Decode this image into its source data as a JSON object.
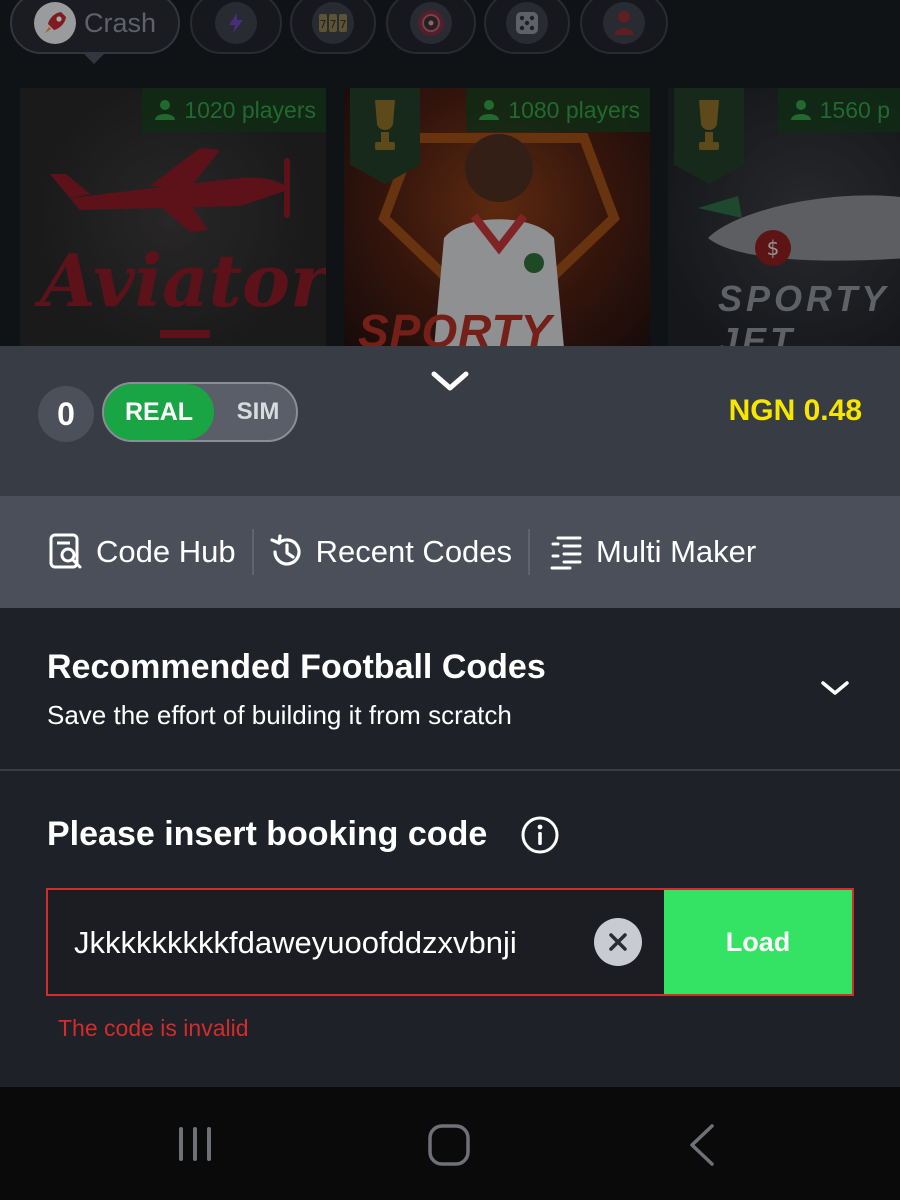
{
  "categories": {
    "active_label": "Crash",
    "icons": [
      "rocket-icon",
      "lightning-icon",
      "slots-icon",
      "roulette-icon",
      "dice-icon",
      "live-dealer-icon"
    ]
  },
  "games": [
    {
      "name": "Aviator",
      "players": "1020 players"
    },
    {
      "name": "SPORTY HERO",
      "players": "1080 players"
    },
    {
      "name": "SPORTY JET",
      "players": "1560 p"
    }
  ],
  "account": {
    "counter": "0",
    "mode_real": "REAL",
    "mode_sim": "SIM",
    "balance": "NGN 0.48"
  },
  "tools": {
    "code_hub": "Code Hub",
    "recent_codes": "Recent Codes",
    "multi_maker": "Multi Maker"
  },
  "recommended": {
    "title": "Recommended Football Codes",
    "subtitle": "Save the effort of building it from scratch"
  },
  "booking": {
    "title": "Please insert booking code",
    "value": "Jkkkkkkkkkfdaweyuoofddzxvbnji",
    "load_label": "Load",
    "error": "The code is invalid"
  },
  "colors": {
    "accent_green": "#34e363",
    "real_green": "#1aa544",
    "balance_yellow": "#f7e600",
    "error_red": "#d42b2b"
  }
}
